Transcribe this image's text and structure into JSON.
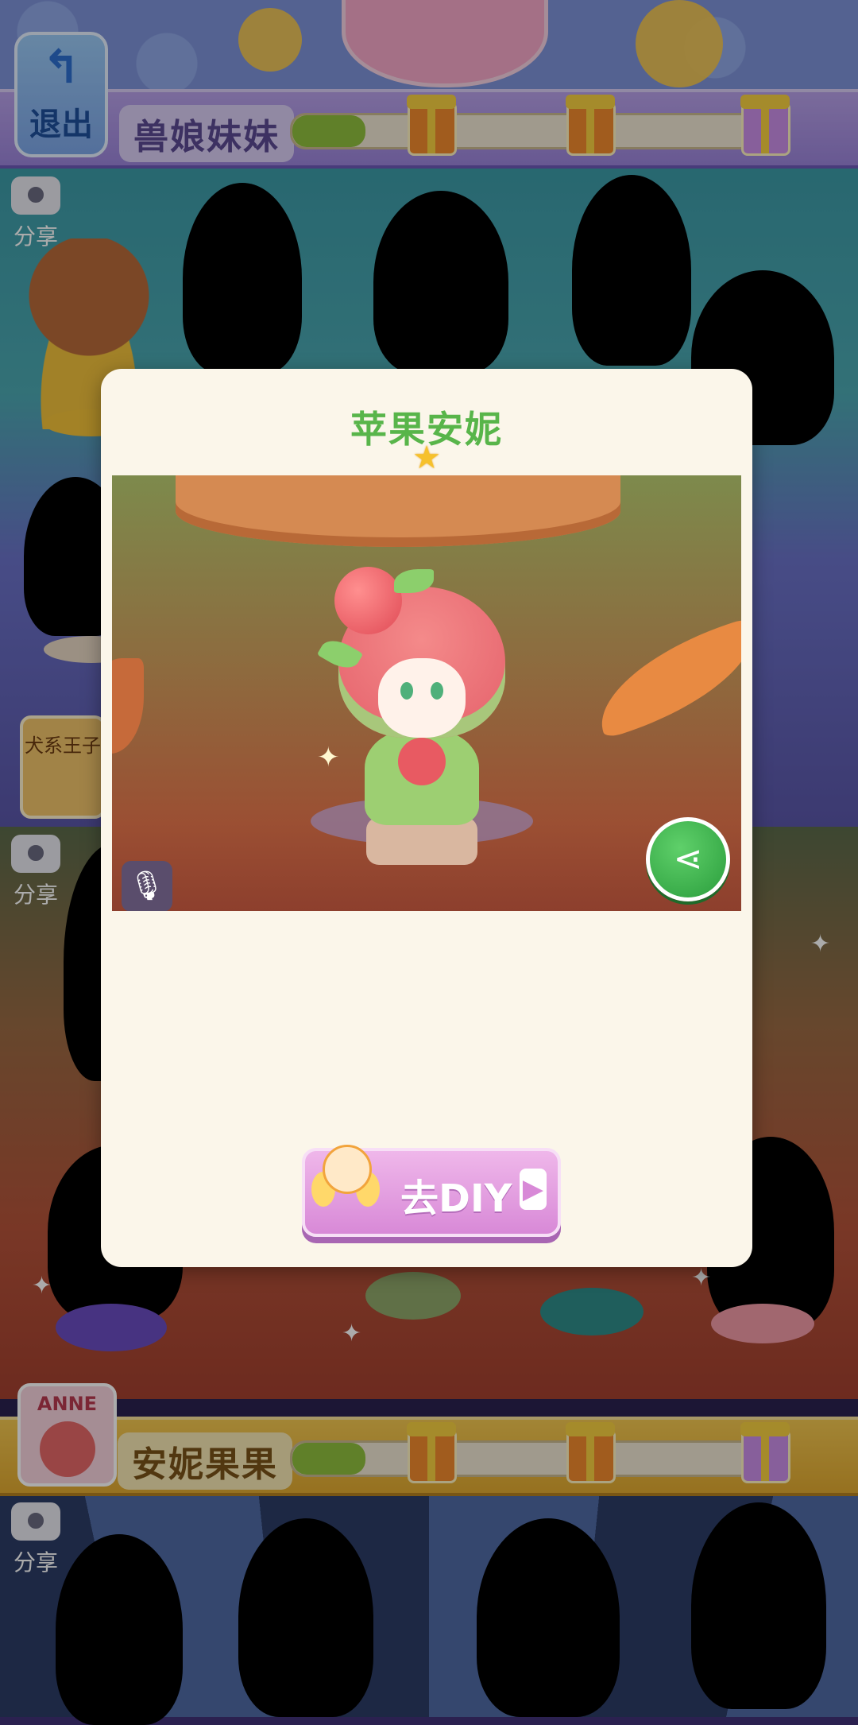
{
  "top_bar": {
    "exit_label": "退出",
    "category_title": "兽娘妹妹",
    "progress": 0.15
  },
  "side": {
    "share_label": "分享",
    "dog_card_label": "犬系王子"
  },
  "bottom_bar": {
    "card_label": "ANNE",
    "category_title": "安妮果果",
    "progress": 0.15
  },
  "modal": {
    "title": "苹果安妮",
    "star_count": 1,
    "diy_button_label": "去DIY"
  },
  "icons": {
    "exit": "back-arrow-icon",
    "camera": "camera-icon",
    "mic": "microphone-icon",
    "share": "share-icon",
    "gift": "gift-box-icon",
    "star": "star-icon",
    "play": "play-arrow-icon"
  },
  "colors": {
    "title_green": "#58b54a",
    "modal_bg": "#fbf6ea",
    "diy_pink": "#d889d7",
    "share_green": "#2a9d3c",
    "progress_green": "#8fbf3e"
  }
}
